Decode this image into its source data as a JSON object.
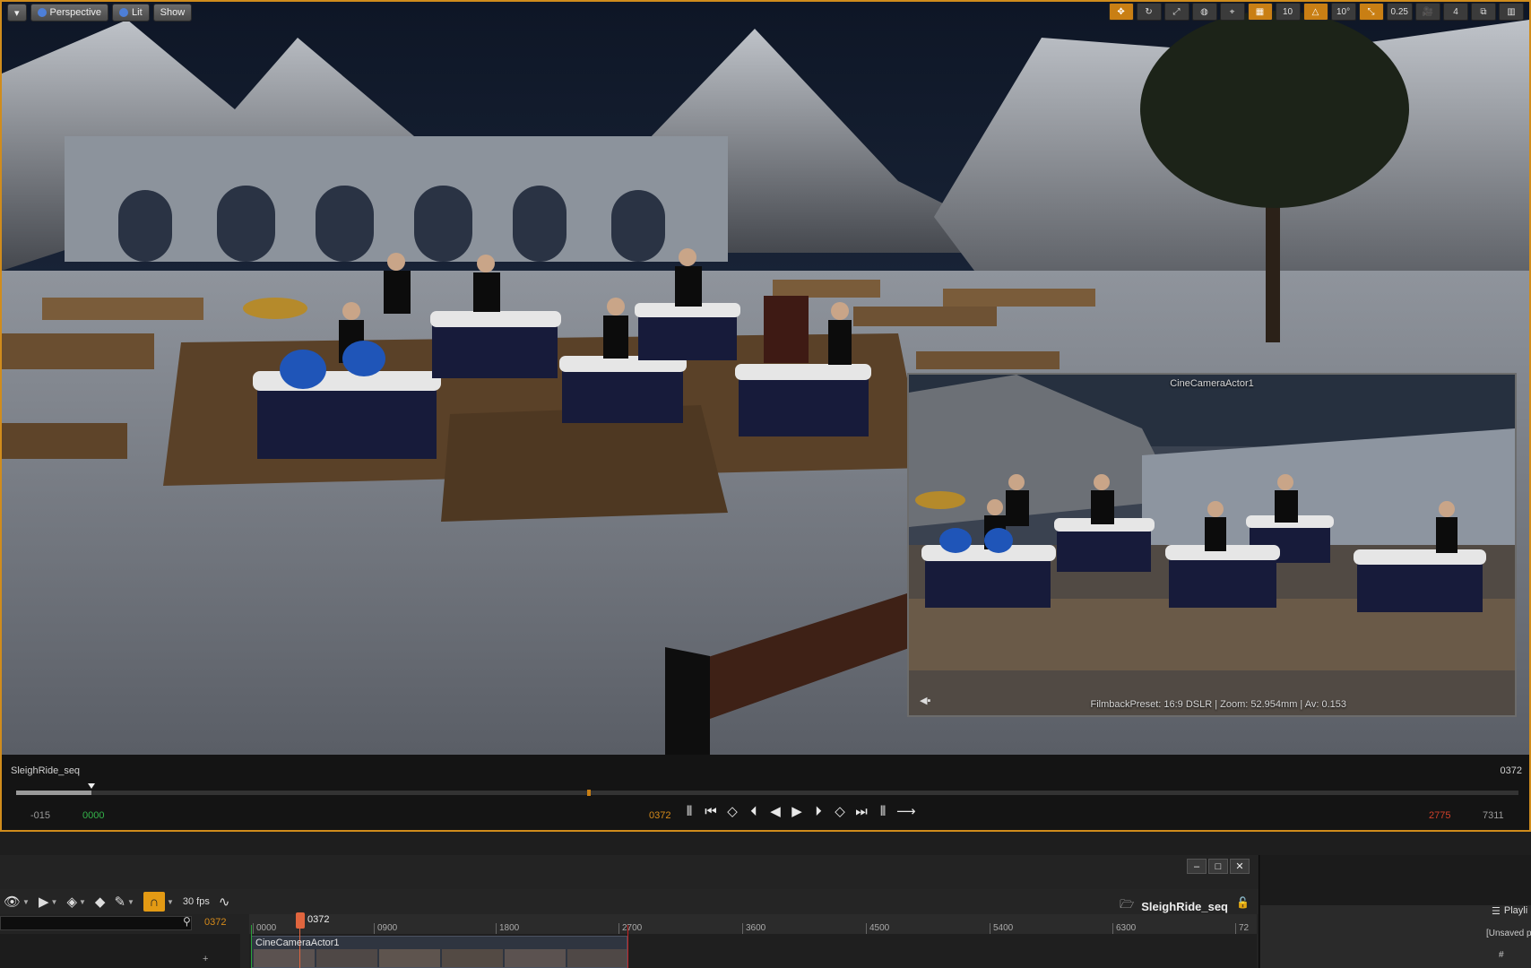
{
  "viewport": {
    "toolbar": {
      "perspective_label": "Perspective",
      "lit_label": "Lit",
      "show_label": "Show",
      "grid_snap_value": "10",
      "rotation_snap_value": "10°",
      "scale_snap_value": "0.25",
      "camera_speed_value": "4"
    },
    "pip": {
      "title": "CineCameraActor1",
      "filmback": "FilmbackPreset: 16:9 DSLR | Zoom: 52.954mm | Av: 0.153"
    },
    "transport": {
      "sequence_name": "SleighRide_seq",
      "current_frame": "0372",
      "start_view": "-015",
      "start_playback": "0000",
      "current_frame_center": "0372",
      "end_playback": "2775",
      "end_view": "7311",
      "playback_fraction": 0.38,
      "playhead_fraction": 0.05
    }
  },
  "sequencer": {
    "fps_label": "30 fps",
    "title": "SleighRide_seq",
    "search_placeholder": "",
    "current_frame": "0372",
    "playhead_label": "0372",
    "ruler_ticks": [
      "0000",
      "0900",
      "1800",
      "2700",
      "3600",
      "4500",
      "5400",
      "6300",
      "72"
    ],
    "track_label": "CineCameraActor1",
    "window_buttons": {
      "minimize": "–",
      "maximize": "□",
      "close": "✕"
    }
  },
  "right_panel": {
    "tab_label": "Playli",
    "unsaved_label": "[Unsaved p",
    "column_hash": "#"
  },
  "icons": {
    "eye": "eye-icon",
    "play": "play-icon",
    "key": "key-icon",
    "curve": "curve-editor-icon",
    "snap": "snap-magnet-icon",
    "folder": "folder-icon",
    "lock": "lock-icon",
    "search": "search-icon"
  },
  "colors": {
    "accent_orange": "#c97f14",
    "playhead_red": "#e0653e",
    "start_green": "#2aa33a",
    "end_red": "#c42323"
  }
}
